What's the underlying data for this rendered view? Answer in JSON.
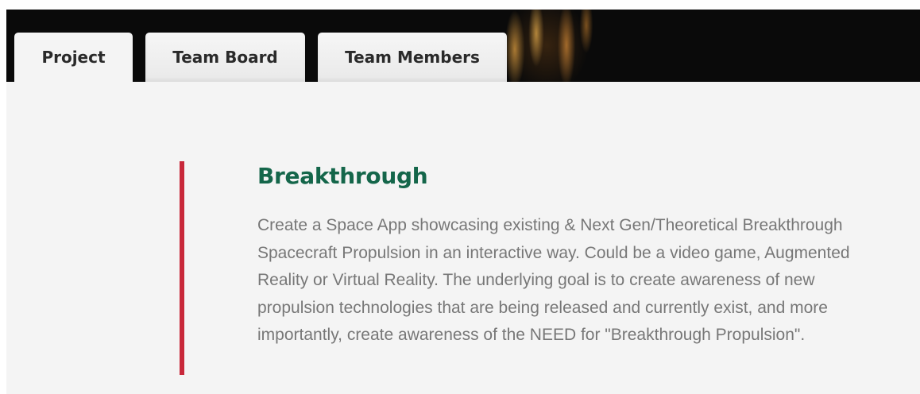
{
  "tabs": [
    {
      "label": "Project",
      "active": true
    },
    {
      "label": "Team Board",
      "active": false
    },
    {
      "label": "Team Members",
      "active": false
    }
  ],
  "challenge": {
    "title": "Breakthrough",
    "description": "Create a Space App showcasing existing & Next Gen/Theoretical Breakthrough Spacecraft Propulsion in an interactive way. Could be a video game, Augmented Reality or Virtual Reality. The underlying goal is to create awareness of new propulsion technologies that are being released and currently exist, and more importantly, create awareness of the NEED for \"Breakthrough Propulsion\"."
  },
  "colors": {
    "title": "#14664a",
    "accent_bar": "#c8283a",
    "body_text": "#777777",
    "background": "#f4f4f4",
    "banner": "#0a0a0a"
  }
}
